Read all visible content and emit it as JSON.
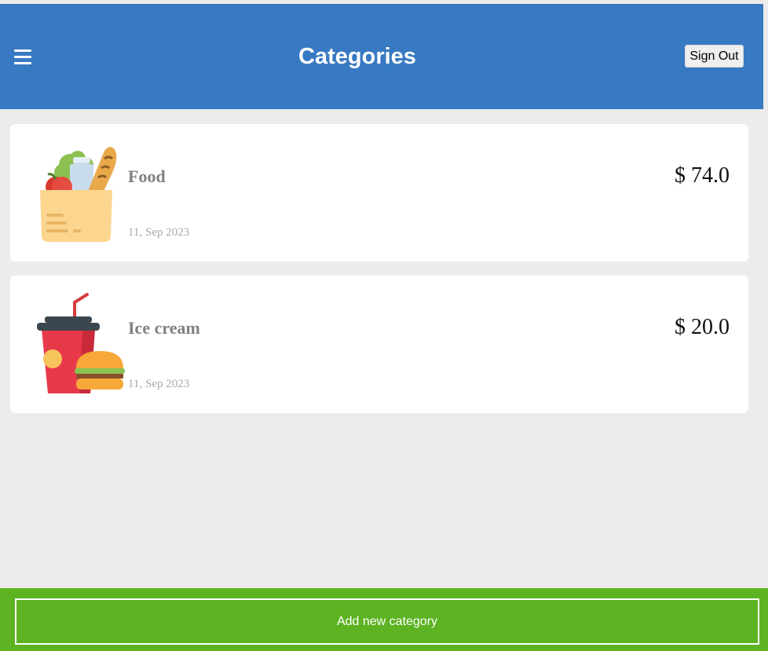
{
  "header": {
    "title": "Categories",
    "menu_icon": "hamburger-menu-icon",
    "sign_out_label": "Sign Out"
  },
  "categories": [
    {
      "icon": "grocery-bag-icon",
      "name": "Food",
      "date": "11, Sep 2023",
      "amount": "$ 74.0"
    },
    {
      "icon": "fast-food-icon",
      "name": "Ice cream",
      "date": "11, Sep 2023",
      "amount": "$ 20.0"
    }
  ],
  "footer": {
    "add_label": "Add new category"
  },
  "colors": {
    "header_bg": "#3779c2",
    "footer_bg": "#5db321",
    "page_bg": "#ececec"
  }
}
